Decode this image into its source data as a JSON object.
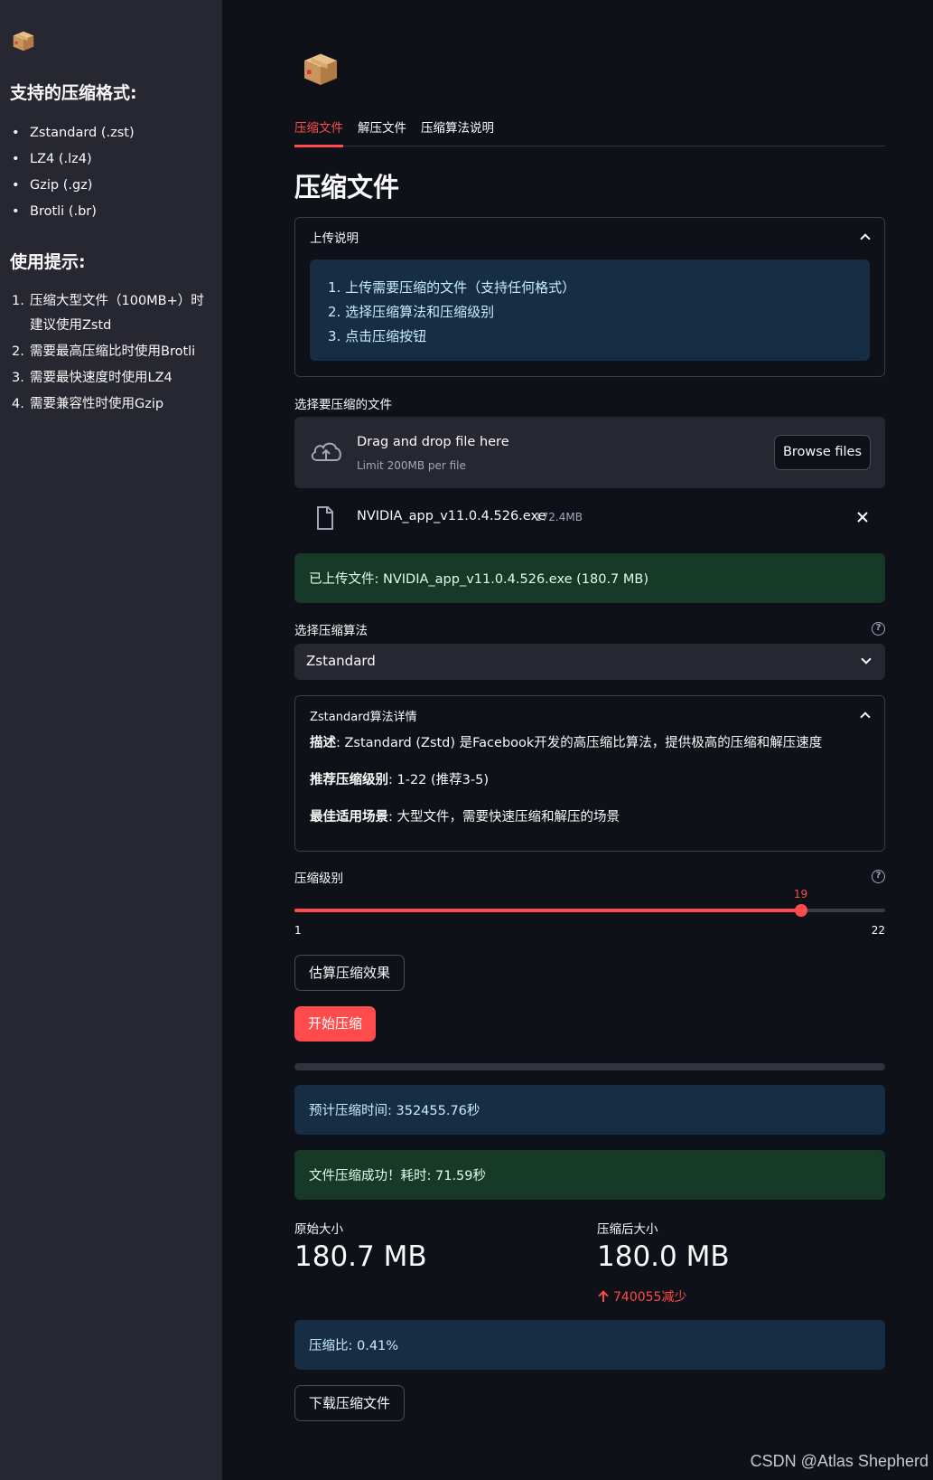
{
  "sidebar": {
    "logo_icon": "package-icon",
    "formats_title": "支持的压缩格式:",
    "formats": [
      "Zstandard (.zst)",
      "LZ4 (.lz4)",
      "Gzip (.gz)",
      "Brotli (.br)"
    ],
    "tips_title": "使用提示:",
    "tips": [
      {
        "num": "1.",
        "text": "压缩大型文件（100MB+）时建议使用Zstd"
      },
      {
        "num": "2.",
        "text": "需要最高压缩比时使用Brotli"
      },
      {
        "num": "3.",
        "text": "需要最快速度时使用LZ4"
      },
      {
        "num": "4.",
        "text": "需要兼容性时使用Gzip"
      }
    ]
  },
  "main": {
    "logo_icon": "package-icon",
    "tabs": [
      "压缩文件",
      "解压文件",
      "压缩算法说明"
    ],
    "title": "压缩文件",
    "instructions": {
      "title": "上传说明",
      "steps": [
        {
          "num": "1.",
          "text": "上传需要压缩的文件（支持任何格式）"
        },
        {
          "num": "2.",
          "text": "选择压缩算法和压缩级别"
        },
        {
          "num": "3.",
          "text": "点击压缩按钮"
        }
      ]
    },
    "uploader": {
      "label": "选择要压缩的文件",
      "drag_text": "Drag and drop file here",
      "limit_text": "Limit 200MB per file",
      "browse_label": "Browse files",
      "file_name": "NVIDIA_app_v11.0.4.526.exe",
      "file_size": "172.4MB"
    },
    "uploaded_msg": "已上传文件: NVIDIA_app_v11.0.4.526.exe (180.7 MB)",
    "algorithm": {
      "label": "选择压缩算法",
      "selected": "Zstandard"
    },
    "details": {
      "title": "Zstandard算法详情",
      "desc_label": "描述",
      "desc": ": Zstandard (Zstd) 是Facebook开发的高压缩比算法，提供极高的压缩和解压速度",
      "level_label": "推荐压缩级别",
      "level": ": 1-22 (推荐3-5)",
      "scene_label": "最佳适用场景",
      "scene": ": 大型文件，需要快速压缩和解压的场景"
    },
    "level_slider": {
      "label": "压缩级别",
      "value": 19,
      "min": 1,
      "max": 22,
      "value_text": "19",
      "min_text": "1",
      "max_text": "22"
    },
    "estimate_button": "估算压缩效果",
    "start_button": "开始压缩",
    "progress": 0,
    "estimate_msg": "预计压缩时间: 352455.76秒",
    "success_msg": "文件压缩成功！耗时: 71.59秒",
    "metrics": {
      "original_label": "原始大小",
      "original_value": "180.7 MB",
      "compressed_label": "压缩后大小",
      "compressed_value": "180.0 MB",
      "delta": "740055减少"
    },
    "ratio_msg": "压缩比: 0.41%",
    "download_button": "下载压缩文件"
  },
  "watermark": "CSDN @Atlas Shepherd",
  "colors": {
    "accent": "#ff4b4b",
    "background": "#0e1117",
    "sidebar": "#262730",
    "info_bg": "#172d43",
    "success_bg": "#173928"
  }
}
